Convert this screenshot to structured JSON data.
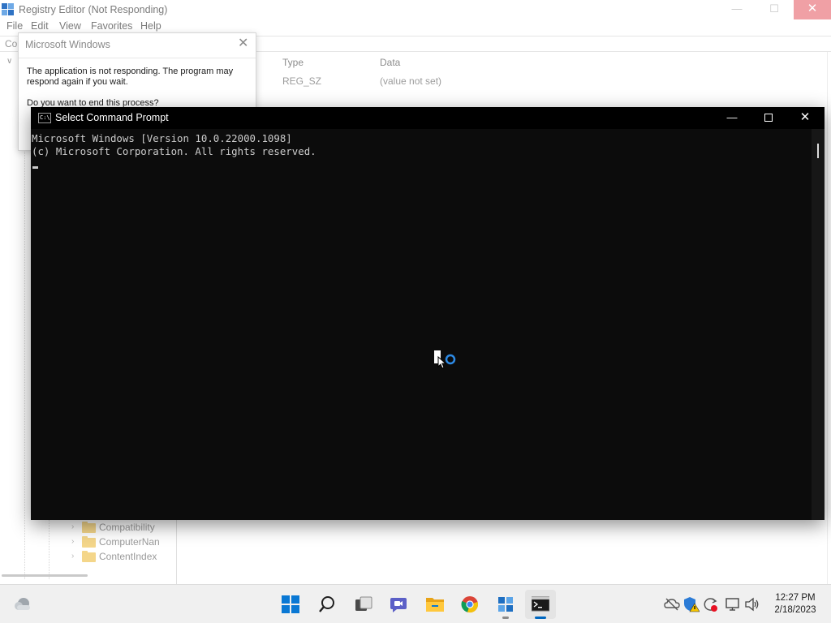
{
  "regedit": {
    "title": "Registry Editor (Not Responding)",
    "menu": [
      "File",
      "Edit",
      "View",
      "Favorites",
      "Help"
    ],
    "address_fragment": "Co",
    "columns": {
      "type": "Type",
      "data": "Data"
    },
    "default_value": {
      "type": "REG_SZ",
      "data": "(value not set)"
    },
    "tree_items": [
      "Compatibility",
      "ComputerNan",
      "ContentIndex"
    ]
  },
  "dialog": {
    "title": "Microsoft Windows",
    "message": "The application is not responding. The program may respond again if you wait.",
    "question": "Do you want to end this process?"
  },
  "cmd": {
    "title": "Select Command Prompt",
    "lines": [
      "Microsoft Windows [Version 10.0.22000.1098]",
      "(c) Microsoft Corporation. All rights reserved."
    ],
    "icon_text": "C:\\"
  },
  "taskbar": {
    "pinned": [
      "start-icon",
      "search-icon",
      "task-view-icon",
      "teams-chat-icon",
      "file-explorer-icon",
      "chrome-icon",
      "registry-editor-icon",
      "command-prompt-icon"
    ],
    "clock": {
      "time": "12:27 PM",
      "date": "2/18/2023"
    }
  },
  "colors": {
    "accent": "#0067c0",
    "console_bg": "#0c0c0c",
    "console_text": "#cccccc",
    "close_hover": "#e81123"
  }
}
